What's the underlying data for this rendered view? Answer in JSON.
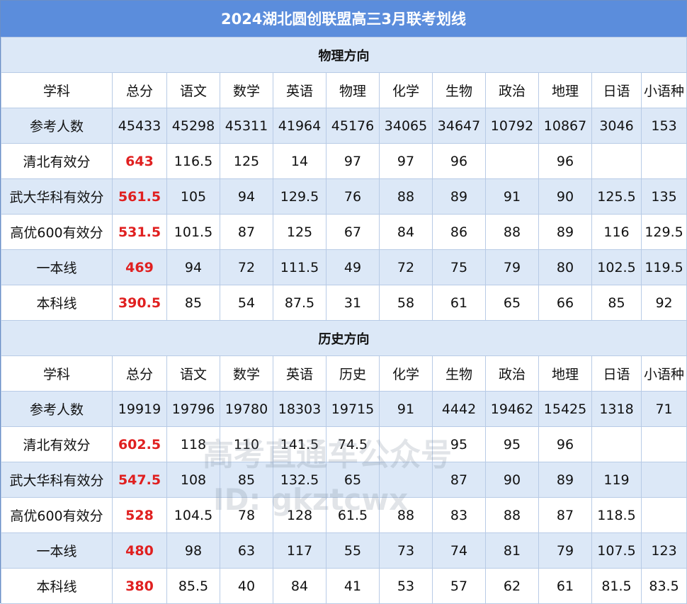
{
  "title": "2024湖北圆创联盟高三3月联考划线",
  "header_columns_physics": [
    "学科",
    "总分",
    "语文",
    "数学",
    "英语",
    "物理",
    "化学",
    "生物",
    "政治",
    "地理",
    "日语",
    "小语种"
  ],
  "header_columns_history": [
    "学科",
    "总分",
    "语文",
    "数学",
    "英语",
    "历史",
    "化学",
    "生物",
    "政治",
    "地理",
    "日语",
    "小语种"
  ],
  "sections": [
    {
      "name": "物理方向",
      "rows": [
        [
          "参考人数",
          "45433",
          "45298",
          "45311",
          "41964",
          "45176",
          "34065",
          "34647",
          "10792",
          "10867",
          "3046",
          "153"
        ],
        [
          "清北有效分",
          "643",
          "116.5",
          "125",
          "14",
          "97",
          "97",
          "96",
          "",
          "96",
          "",
          ""
        ],
        [
          "武大华科有效分",
          "561.5",
          "105",
          "94",
          "129.5",
          "76",
          "88",
          "89",
          "91",
          "90",
          "125.5",
          "135"
        ],
        [
          "高优600有效分",
          "531.5",
          "101.5",
          "87",
          "125",
          "67",
          "84",
          "86",
          "88",
          "89",
          "116",
          "129.5"
        ],
        [
          "一本线",
          "469",
          "94",
          "72",
          "111.5",
          "49",
          "72",
          "75",
          "79",
          "80",
          "102.5",
          "119.5"
        ],
        [
          "本科线",
          "390.5",
          "85",
          "54",
          "87.5",
          "31",
          "58",
          "61",
          "65",
          "66",
          "85",
          "92"
        ]
      ]
    },
    {
      "name": "历史方向",
      "rows": [
        [
          "参考人数",
          "19919",
          "19796",
          "19780",
          "18303",
          "19715",
          "91",
          "4442",
          "19462",
          "15425",
          "1318",
          "71"
        ],
        [
          "清北有效分",
          "602.5",
          "118",
          "110",
          "141.5",
          "74.5",
          "",
          "95",
          "95",
          "96",
          "",
          ""
        ],
        [
          "武大华科有效分",
          "547.5",
          "108",
          "85",
          "132.5",
          "65",
          "",
          "87",
          "90",
          "89",
          "119",
          ""
        ],
        [
          "高优600有效分",
          "528",
          "104.5",
          "78",
          "128",
          "61.5",
          "88",
          "83",
          "88",
          "87",
          "118.5",
          ""
        ],
        [
          "一本线",
          "480",
          "98",
          "63",
          "117",
          "55",
          "73",
          "74",
          "81",
          "79",
          "107.5",
          "123"
        ],
        [
          "本科线",
          "380",
          "85.5",
          "40",
          "84",
          "41",
          "53",
          "57",
          "62",
          "61",
          "81.5",
          "83.5"
        ]
      ]
    }
  ],
  "watermark": {
    "line1": "高考直通车公众号",
    "line2": "ID: gkztcwx"
  },
  "colors": {
    "title_bg": "#5b8ddc",
    "shade": "#dce8f7",
    "total_text": "#e02020",
    "border": "#b8cbe6"
  }
}
